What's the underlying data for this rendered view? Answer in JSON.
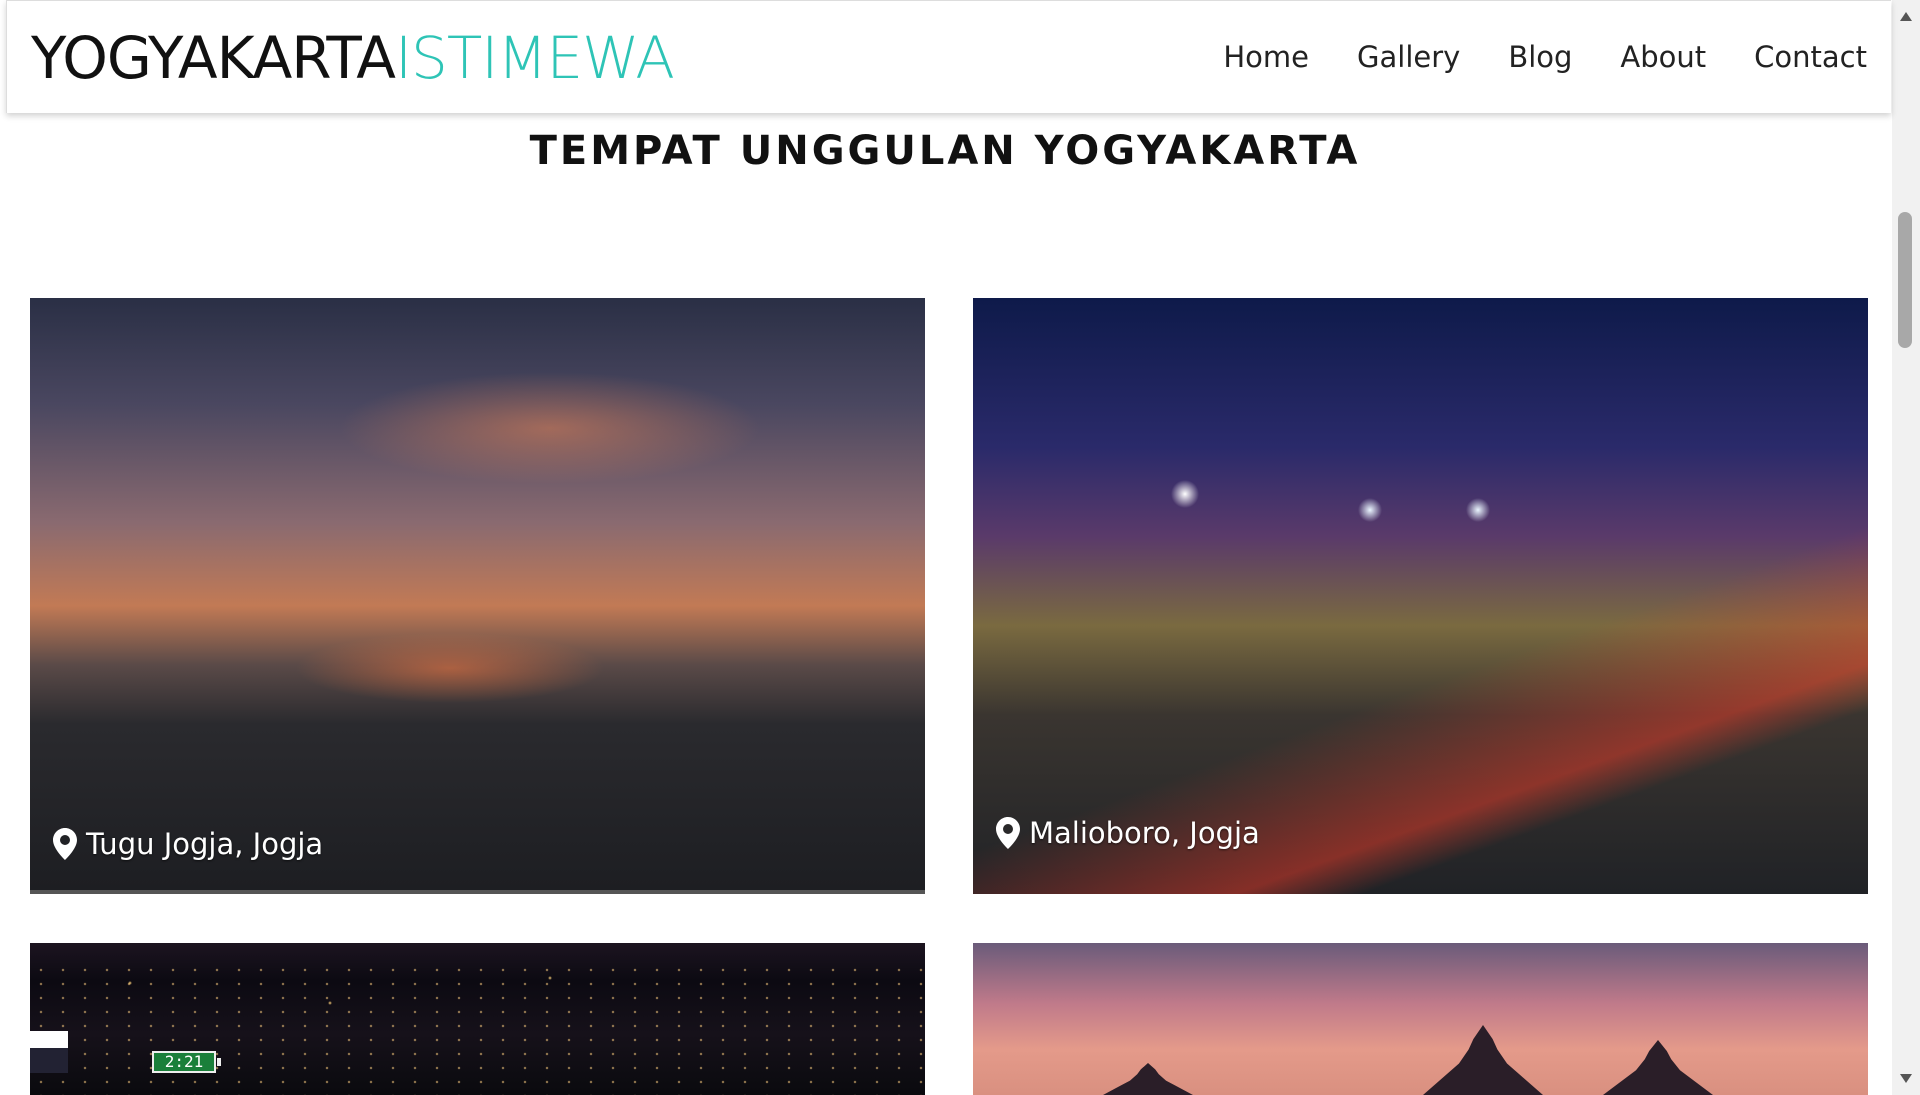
{
  "header": {
    "brand_primary": "YOGYAKARTA",
    "brand_accent": "ISTIMEWA",
    "nav": [
      "Home",
      "Gallery",
      "Blog",
      "About",
      "Contact"
    ]
  },
  "main": {
    "section_title": "TEMPAT UNGGULAN YOGYAKARTA",
    "cards": [
      {
        "caption": "Tugu Jogja, Jogja",
        "icon": "map-marker-icon"
      },
      {
        "caption": "Malioboro, Jogja",
        "icon": "map-marker-icon"
      },
      {
        "caption": "",
        "overlay_text": "2:21"
      },
      {
        "caption": ""
      }
    ]
  },
  "colors": {
    "brand_accent": "#2ec4b6",
    "text": "#111111"
  }
}
